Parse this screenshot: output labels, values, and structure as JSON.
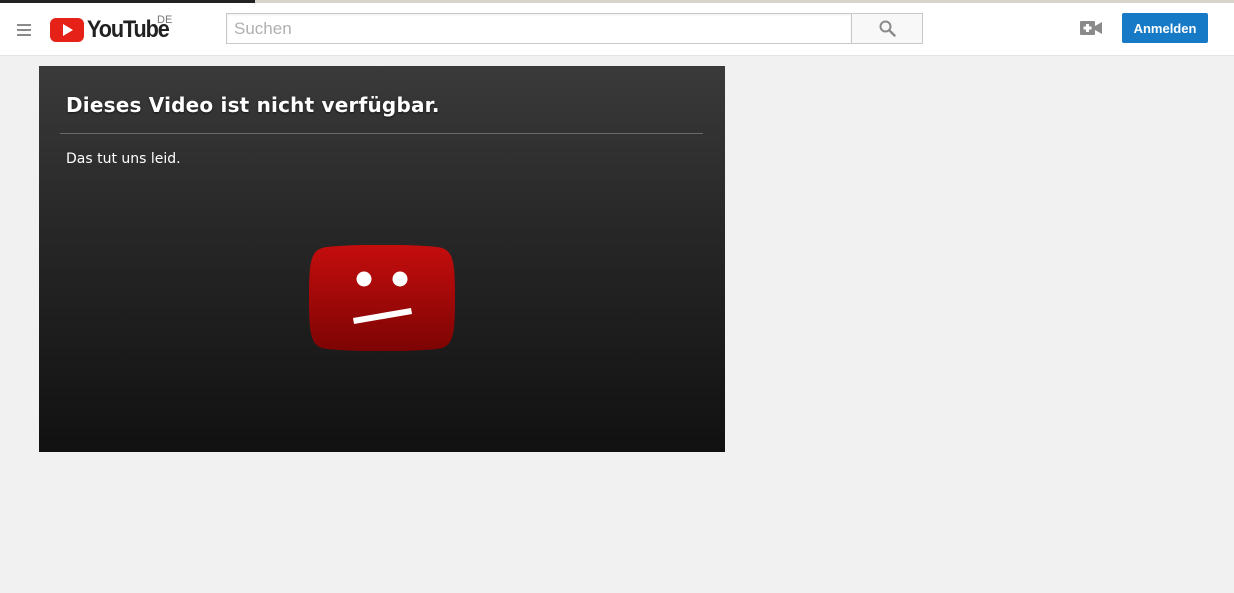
{
  "header": {
    "logo": {
      "wordmark": "YouTube",
      "country_code": "DE",
      "icon": "youtube-play-logo-icon"
    },
    "menu_icon": "hamburger-menu-icon",
    "search": {
      "placeholder": "Suchen",
      "value": "",
      "button_icon": "search-icon"
    },
    "upload_icon": "video-upload-icon",
    "signin_label": "Anmelden"
  },
  "player": {
    "title": "Dieses Video ist nicht verfügbar.",
    "message": "Das tut uns leid.",
    "icon": "sad-youtube-icon"
  },
  "colors": {
    "brand_red": "#e62117",
    "signin_blue": "#167ac6",
    "background": "#f1f1f1"
  }
}
